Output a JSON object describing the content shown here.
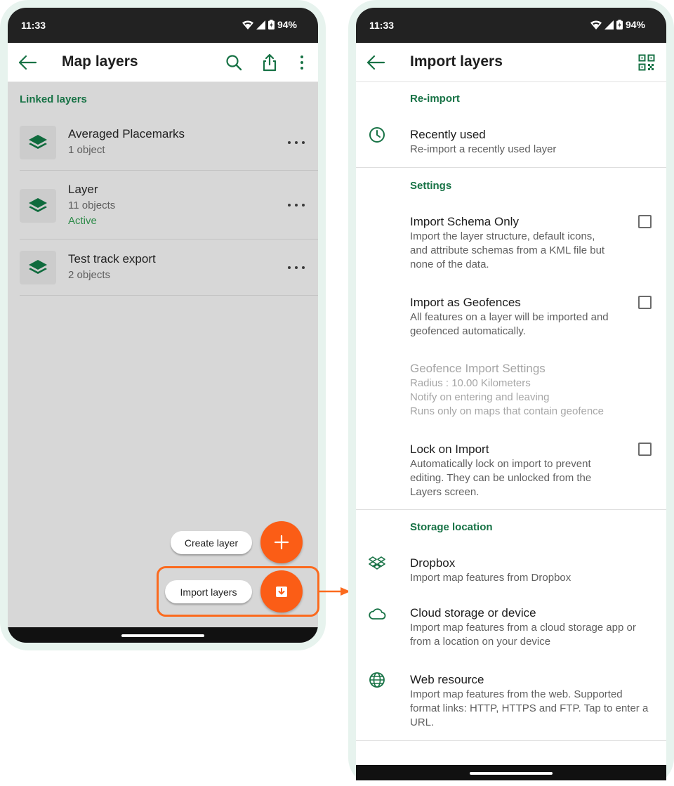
{
  "status_bar": {
    "time": "11:33",
    "battery": "94%"
  },
  "left_screen": {
    "appbar": {
      "title": "Map layers"
    },
    "section": "Linked layers",
    "layers": [
      {
        "name": "Averaged Placemarks",
        "count": "1 object",
        "status": ""
      },
      {
        "name": "Layer",
        "count": "11 objects",
        "status": "Active"
      },
      {
        "name": "Test track export",
        "count": "2 objects",
        "status": ""
      }
    ],
    "fab_create_label": "Create layer",
    "fab_import_label": "Import layers"
  },
  "right_screen": {
    "appbar": {
      "title": "Import layers"
    },
    "sections": {
      "reimport": "Re-import",
      "settings": "Settings",
      "storage": "Storage location"
    },
    "recently_used": {
      "title": "Recently used",
      "desc": "Re-import a recently used layer"
    },
    "import_schema_only": {
      "title": "Import Schema Only",
      "desc": "Import the layer structure, default icons, and attribute schemas from a KML file but none of the data.",
      "checked": false
    },
    "import_as_geofences": {
      "title": "Import as Geofences",
      "desc": "All features on a layer will be imported and geofenced automatically.",
      "checked": false
    },
    "geofence_settings": {
      "title": "Geofence Import Settings",
      "radius": "Radius : 10.00 Kilometers",
      "notify": "Notify on entering and leaving",
      "runs": "Runs only on maps that contain geofence"
    },
    "lock_on_import": {
      "title": "Lock on Import",
      "desc": "Automatically lock on import to prevent editing. They can be unlocked from the Layers screen.",
      "checked": false
    },
    "dropbox": {
      "title": "Dropbox",
      "desc": "Import map features from Dropbox"
    },
    "cloud": {
      "title": "Cloud storage or device",
      "desc": "Import map features from a cloud storage app or from a location on your device"
    },
    "web": {
      "title": "Web resource",
      "desc": "Import map features from the web. Supported format links: HTTP, HTTPS and FTP. Tap to enter a URL."
    }
  },
  "colors": {
    "accent_green": "#177245",
    "fab_orange": "#fb5d16",
    "highlight_orange": "#fb6a1e",
    "phone_frame": "#e7f3ee"
  },
  "icons": {
    "back": "arrow-left-icon",
    "search": "search-icon",
    "share": "share-icon",
    "more": "more-vertical-icon",
    "qr": "qr-code-icon",
    "layer": "layers-icon",
    "history": "clock-icon",
    "dropbox": "dropbox-icon",
    "cloud": "cloud-icon",
    "web": "globe-icon",
    "plus": "plus-icon",
    "import": "import-icon"
  }
}
